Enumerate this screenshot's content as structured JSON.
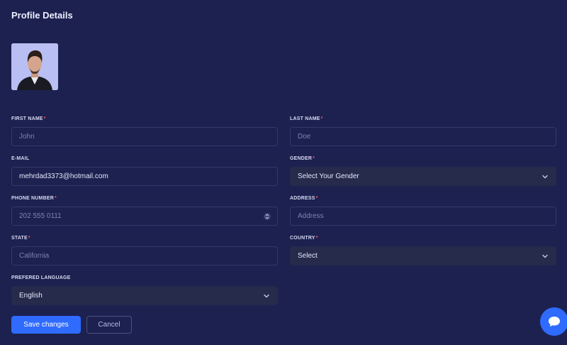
{
  "page": {
    "title": "Profile Details"
  },
  "avatar": {
    "alt": "profile-photo"
  },
  "form": {
    "first_name": {
      "label": "FIRST NAME",
      "placeholder": "John",
      "required": "*"
    },
    "last_name": {
      "label": "LAST NAME",
      "placeholder": "Doe",
      "required": "*"
    },
    "email": {
      "label": "E-MAIL",
      "value": "mehrdad3373@hotmail.com"
    },
    "gender": {
      "label": "GENDER",
      "selected": "Select Your Gender",
      "required": "*"
    },
    "phone": {
      "label": "PHONE NUMBER",
      "placeholder": "202 555 0111",
      "required": "*"
    },
    "address": {
      "label": "ADDRESS",
      "placeholder": "Address",
      "required": "*"
    },
    "state": {
      "label": "STATE",
      "placeholder": "California",
      "required": "*"
    },
    "country": {
      "label": "COUNTRY",
      "selected": "Select",
      "required": "*"
    },
    "language": {
      "label": "PREFERED LANGUAGE",
      "selected": "English"
    }
  },
  "actions": {
    "save_label": "Save changes",
    "cancel_label": "Cancel"
  },
  "colors": {
    "background": "#1c2150",
    "accent": "#2f6bff",
    "required": "#ff4d5e",
    "select_bg": "#262a4b"
  },
  "icons": {
    "chat": "chat-bubble-icon",
    "dropdown": "chevron-down-icon",
    "stepper": "stepper-icon"
  }
}
